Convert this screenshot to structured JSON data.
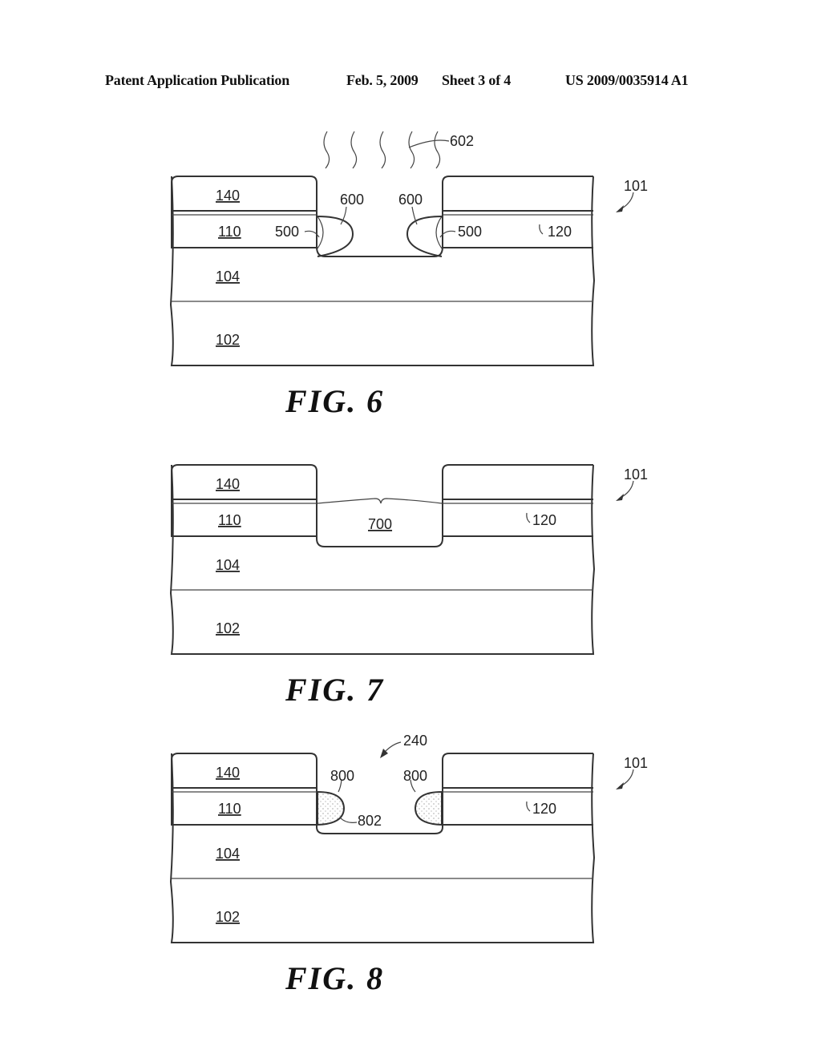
{
  "header": {
    "left": "Patent Application Publication",
    "date": "Feb. 5, 2009",
    "sheet": "Sheet 3 of 4",
    "number": "US 2009/0035914 A1"
  },
  "figures": [
    {
      "caption": "FIG. 6",
      "labels": {
        "l140": "140",
        "l110": "110",
        "l104": "104",
        "l102": "102",
        "l500a": "500",
        "l500b": "500",
        "l600a": "600",
        "l600b": "600",
        "l602": "602",
        "l120": "120",
        "l101": "101"
      }
    },
    {
      "caption": "FIG. 7",
      "labels": {
        "l140": "140",
        "l110": "110",
        "l104": "104",
        "l102": "102",
        "l700": "700",
        "l120": "120",
        "l101": "101"
      }
    },
    {
      "caption": "FIG. 8",
      "labels": {
        "l140": "140",
        "l110": "110",
        "l104": "104",
        "l102": "102",
        "l800a": "800",
        "l800b": "800",
        "l802": "802",
        "l240": "240",
        "l120": "120",
        "l101": "101"
      }
    }
  ]
}
